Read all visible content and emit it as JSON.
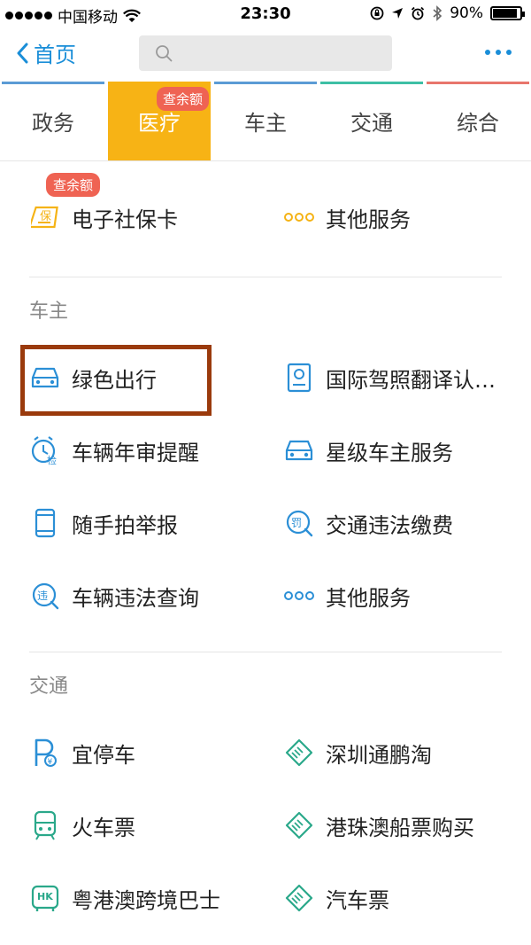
{
  "status_bar": {
    "carrier": "中国移动",
    "time": "23:30",
    "battery": "90%",
    "battery_level": 0.9
  },
  "nav": {
    "back_label": "首页",
    "search_placeholder": ""
  },
  "tabs": [
    {
      "label": "政务",
      "color": "#5b9bd5"
    },
    {
      "label": "医疗",
      "badge": "查余额",
      "active": true,
      "color": "#f7b315"
    },
    {
      "label": "车主",
      "color": "#5b9bd5"
    },
    {
      "label": "交通",
      "color": "#3dbfa5"
    },
    {
      "label": "综合",
      "color": "#e8756c"
    }
  ],
  "medical": {
    "items": [
      {
        "label": "电子社保卡",
        "badge": "查余额",
        "icon": "social-security-card-icon"
      },
      {
        "label": "其他服务",
        "icon": "more-services-icon"
      }
    ]
  },
  "car_owner": {
    "title": "车主",
    "items": [
      {
        "label": "绿色出行",
        "icon": "car-icon"
      },
      {
        "label": "国际驾照翻译认…",
        "icon": "license-document-icon"
      },
      {
        "label": "车辆年审提醒",
        "icon": "inspection-clock-icon"
      },
      {
        "label": "星级车主服务",
        "icon": "car-icon"
      },
      {
        "label": "随手拍举报",
        "icon": "phone-icon"
      },
      {
        "label": "交通违法缴费",
        "icon": "fine-payment-icon"
      },
      {
        "label": "车辆违法查询",
        "icon": "violation-search-icon"
      },
      {
        "label": "其他服务",
        "icon": "more-services-icon"
      }
    ]
  },
  "traffic": {
    "title": "交通",
    "items": [
      {
        "label": "宜停车",
        "icon": "parking-icon"
      },
      {
        "label": "深圳通鹏淘",
        "icon": "ticket-icon"
      },
      {
        "label": "火车票",
        "icon": "train-icon"
      },
      {
        "label": "港珠澳船票购买",
        "icon": "ticket-icon"
      },
      {
        "label": "粤港澳跨境巴士",
        "icon": "bus-hk-icon"
      },
      {
        "label": "汽车票",
        "icon": "ticket-icon"
      }
    ]
  },
  "colors": {
    "accent": "#1a8ed8",
    "tab_active": "#f7b315",
    "badge": "#ef6353",
    "icon_blue": "#2b8fd6",
    "icon_teal": "#2aa88a",
    "icon_yellow": "#f5b315",
    "highlight_border": "#9a3a0c"
  }
}
